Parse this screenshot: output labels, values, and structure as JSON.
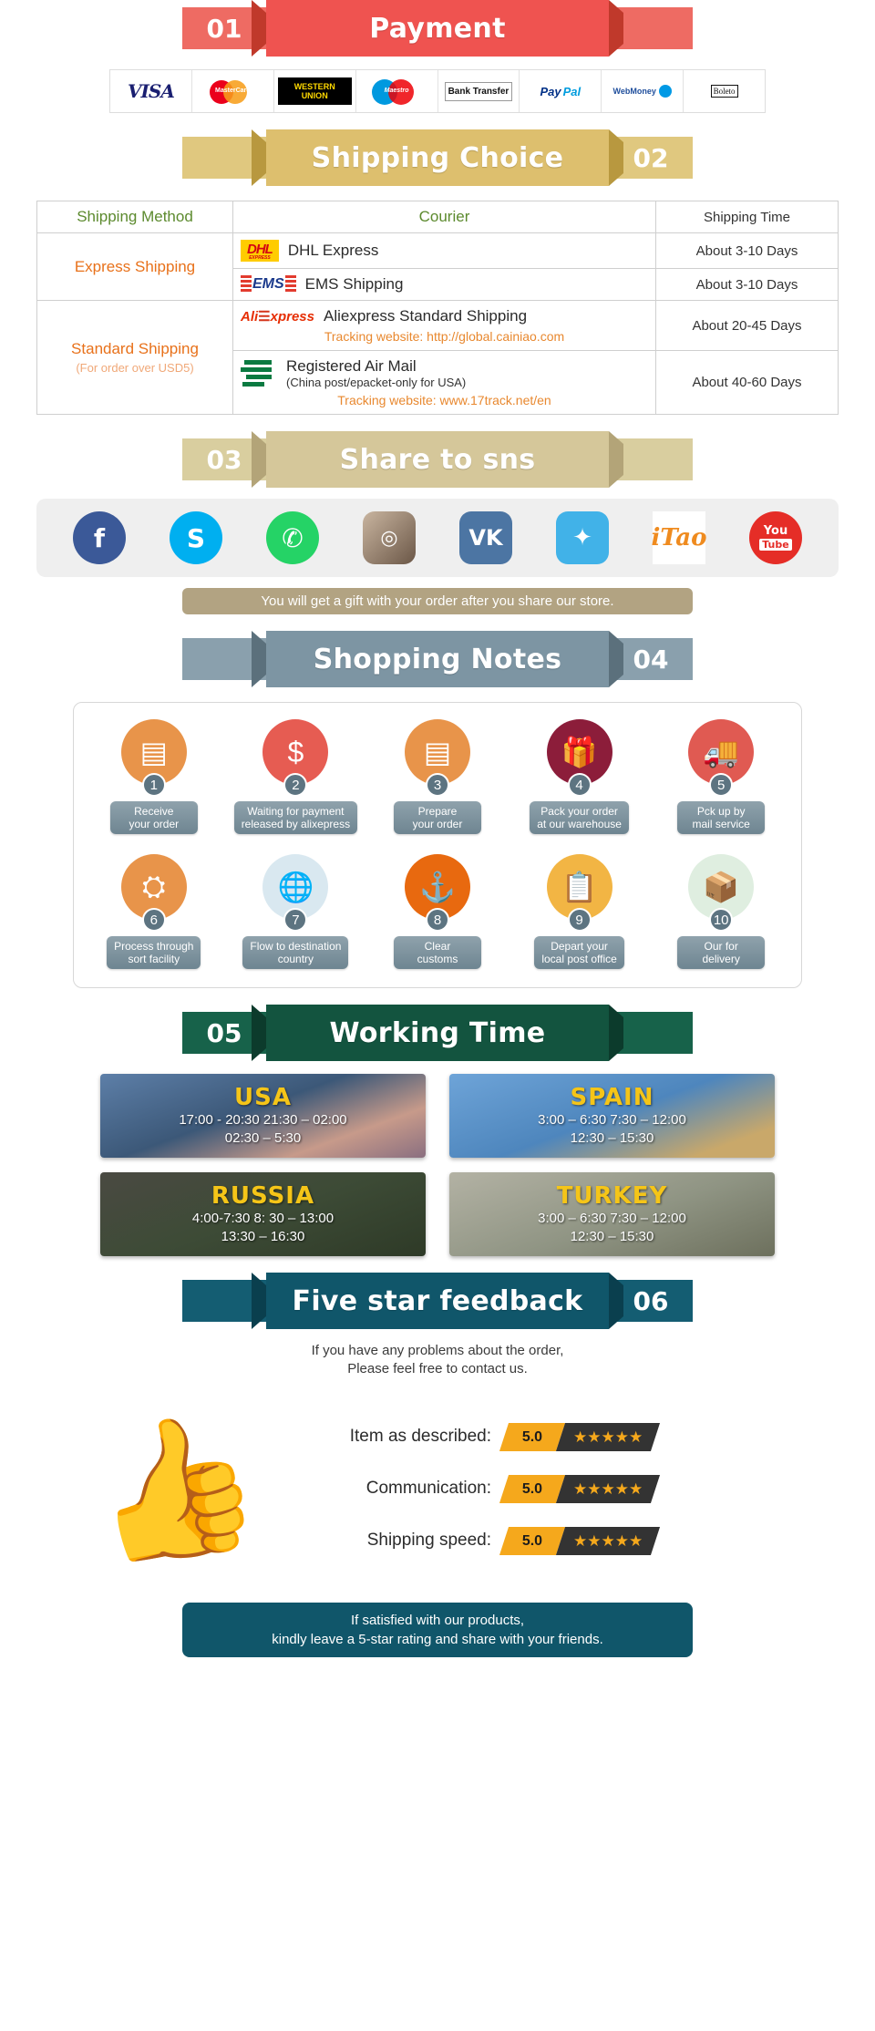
{
  "sections": {
    "payment": {
      "number": "01",
      "title": "Payment",
      "num_side": "left"
    },
    "shipping": {
      "number": "02",
      "title": "Shipping Choice",
      "num_side": "right"
    },
    "share": {
      "number": "03",
      "title": "Share to sns",
      "num_side": "left"
    },
    "notes": {
      "number": "04",
      "title": "Shopping Notes",
      "num_side": "right"
    },
    "working": {
      "number": "05",
      "title": "Working Time",
      "num_side": "left"
    },
    "feedback": {
      "number": "06",
      "title": "Five star feedback",
      "num_side": "right"
    }
  },
  "payment_methods": [
    {
      "name": "visa",
      "label": "VISA"
    },
    {
      "name": "mastercard",
      "label": "MasterCard"
    },
    {
      "name": "western-union",
      "label": "WESTERN UNION"
    },
    {
      "name": "maestro",
      "label": "Maestro"
    },
    {
      "name": "bank-transfer",
      "label": "Bank Transfer"
    },
    {
      "name": "paypal",
      "label": "PayPal",
      "label_a": "Pay",
      "label_b": "Pal"
    },
    {
      "name": "webmoney",
      "label": "WebMoney"
    },
    {
      "name": "boleto",
      "label": "Boleto"
    }
  ],
  "shipping_table": {
    "headers": [
      "Shipping Method",
      "Courier",
      "Shipping Time"
    ],
    "rows": [
      {
        "method": "Express Shipping",
        "method_note": "",
        "courier": "DHL Express",
        "courier_sub": "",
        "tracking": "",
        "time": "About 3-10 Days",
        "logo": "dhl-logo"
      },
      {
        "method": "",
        "method_note": "",
        "courier": "EMS Shipping",
        "courier_sub": "",
        "tracking": "",
        "time": "About 3-10 Days",
        "logo": "ems-logo"
      },
      {
        "method": "Standard Shipping",
        "method_note": "(For order over USD5)",
        "courier": "Aliexpress Standard Shipping",
        "courier_sub": "",
        "tracking": "Tracking website: http://global.cainiao.com",
        "time": "About 20-45 Days",
        "logo": "aliexpress-logo"
      },
      {
        "method": "",
        "method_note": "",
        "courier": "Registered Air Mail",
        "courier_sub": "(China post/epacket-only for USA)",
        "tracking": "Tracking website: www.17track.net/en",
        "time": "About 40-60 Days",
        "logo": "china-post-logo"
      }
    ]
  },
  "social": {
    "icons": [
      {
        "name": "facebook-icon",
        "glyph": "f"
      },
      {
        "name": "skype-icon",
        "glyph": "S"
      },
      {
        "name": "whatsapp-icon",
        "glyph": "✆"
      },
      {
        "name": "instagram-icon",
        "glyph": "◎"
      },
      {
        "name": "vk-icon",
        "glyph": "VK"
      },
      {
        "name": "twitter-icon",
        "glyph": "✦"
      },
      {
        "name": "itao-icon",
        "glyph": "iTao"
      },
      {
        "name": "youtube-icon",
        "glyph": "You",
        "glyph2": "Tube"
      }
    ],
    "gift_text": "You will get a gift with your order after you share our store."
  },
  "shopping_notes": {
    "steps": [
      {
        "num": "1",
        "label": "Receive\nyour order",
        "icon": "document-icon",
        "color": "#e8944a"
      },
      {
        "num": "2",
        "label": "Waiting for payment\nreleased by alixepress",
        "icon": "money-bag-icon",
        "color": "#e65c52"
      },
      {
        "num": "3",
        "label": "Prepare\nyour order",
        "icon": "document-icon",
        "color": "#e8944a"
      },
      {
        "num": "4",
        "label": "Pack your order\nat our warehouse",
        "icon": "gift-box-icon",
        "color": "#8c1d3a"
      },
      {
        "num": "5",
        "label": "Pck up by\nmail service",
        "icon": "mail-truck-icon",
        "color": "#e05a52"
      },
      {
        "num": "6",
        "label": "Process through\nsort facility",
        "icon": "sort-facility-icon",
        "color": "#e8944a"
      },
      {
        "num": "7",
        "label": "Flow to destination\ncountry",
        "icon": "globe-icon",
        "color": "#d9e8f0"
      },
      {
        "num": "8",
        "label": "Clear\ncustoms",
        "icon": "anchor-icon",
        "color": "#e8690f"
      },
      {
        "num": "9",
        "label": "Depart your\nlocal post office",
        "icon": "clipboard-icon",
        "color": "#f2b544"
      },
      {
        "num": "10",
        "label": "Our for\ndelivery",
        "icon": "package-icon",
        "color": "#dfeee0"
      }
    ]
  },
  "working_time": {
    "cards": [
      {
        "country": "USA",
        "hours_line1": "17:00  -  20:30   21:30  –  02:00",
        "hours_line2": "02:30  –  5:30",
        "theme": "wt-usa"
      },
      {
        "country": "SPAIN",
        "hours_line1": "3:00  –  6:30   7:30  –  12:00",
        "hours_line2": "12:30  –  15:30",
        "theme": "wt-spain"
      },
      {
        "country": "RUSSIA",
        "hours_line1": "4:00-7:30   8: 30  –  13:00",
        "hours_line2": "13:30  –  16:30",
        "theme": "wt-russia"
      },
      {
        "country": "TURKEY",
        "hours_line1": "3:00  –  6:30   7:30  –  12:00",
        "hours_line2": "12:30  –  15:30",
        "theme": "wt-turkey"
      }
    ]
  },
  "feedback": {
    "intro_line1": "If you have any problems about the order,",
    "intro_line2": "Please feel free to contact us.",
    "ratings": [
      {
        "label": "Item as described:",
        "score": "5.0",
        "stars": "★★★★★"
      },
      {
        "label": "Communication:",
        "score": "5.0",
        "stars": "★★★★★"
      },
      {
        "label": "Shipping speed:",
        "score": "5.0",
        "stars": "★★★★★"
      }
    ],
    "footer_line1": "If satisfied with our products,",
    "footer_line2": "kindly leave a 5-star rating and share with your friends."
  }
}
